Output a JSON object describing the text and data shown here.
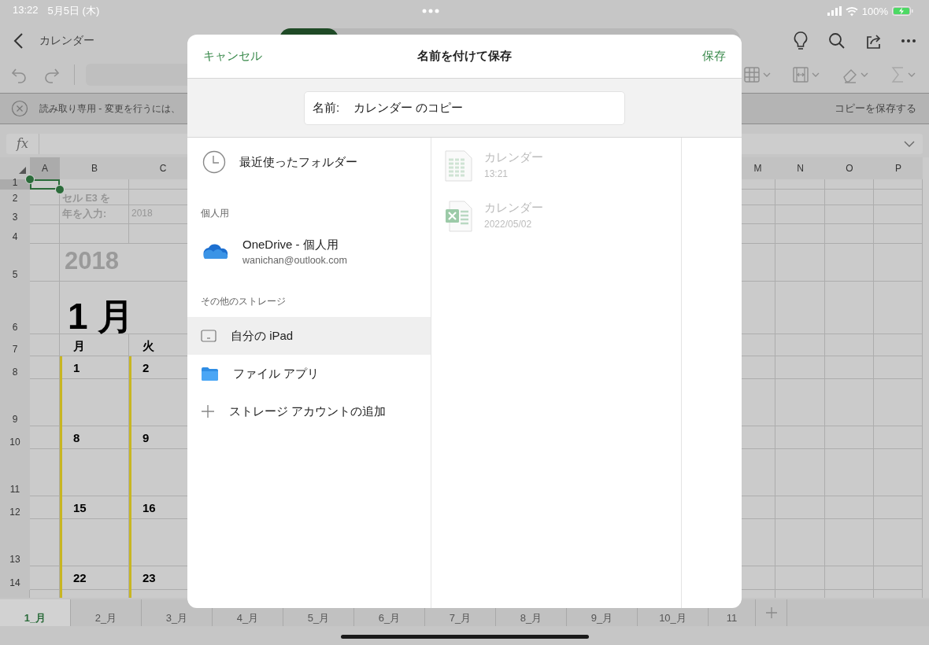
{
  "status_bar": {
    "time": "13:22",
    "date": "5月5日 (木)",
    "battery": "100%"
  },
  "header": {
    "title": "カレンダー"
  },
  "banner": {
    "message": "読み取り専用 - 変更を行うには、",
    "action": "コピーを保存する"
  },
  "formula_bar": {
    "label": "fx"
  },
  "grid": {
    "columns": [
      {
        "label": "A",
        "selected": true
      },
      {
        "label": "B",
        "selected": false
      },
      {
        "label": "C",
        "selected": false
      },
      {
        "label": "M",
        "selected": false
      },
      {
        "label": "N",
        "selected": false
      },
      {
        "label": "O",
        "selected": false
      },
      {
        "label": "P",
        "selected": false
      }
    ],
    "rows": [
      {
        "label": "1",
        "selected": true,
        "kind": "blank"
      },
      {
        "label": "2",
        "selected": false,
        "kind": "note",
        "b": "セル E3 を"
      },
      {
        "label": "3",
        "selected": false,
        "kind": "note",
        "b": "年を入力:",
        "c": "2018"
      },
      {
        "label": "4",
        "selected": false,
        "kind": "blank"
      },
      {
        "label": "5",
        "selected": false,
        "kind": "year",
        "b": "2018"
      },
      {
        "label": "6",
        "selected": false,
        "kind": "month",
        "b": "1 月"
      },
      {
        "label": "7",
        "selected": false,
        "kind": "weekday",
        "b": "月",
        "c": "火"
      },
      {
        "label": "8",
        "selected": false,
        "kind": "date",
        "b": "1",
        "c": "2"
      },
      {
        "label": "9",
        "selected": false,
        "kind": "blank"
      },
      {
        "label": "10",
        "selected": false,
        "kind": "date",
        "b": "8",
        "c": "9"
      },
      {
        "label": "11",
        "selected": false,
        "kind": "blank"
      },
      {
        "label": "12",
        "selected": false,
        "kind": "date",
        "b": "15",
        "c": "16"
      },
      {
        "label": "13",
        "selected": false,
        "kind": "blank"
      },
      {
        "label": "14",
        "selected": false,
        "kind": "date",
        "b": "22",
        "c": "23"
      }
    ]
  },
  "sheet_tabs": [
    {
      "label": "1_月",
      "selected": true
    },
    {
      "label": "2_月",
      "selected": false
    },
    {
      "label": "3_月",
      "selected": false
    },
    {
      "label": "4_月",
      "selected": false
    },
    {
      "label": "5_月",
      "selected": false
    },
    {
      "label": "6_月",
      "selected": false
    },
    {
      "label": "7_月",
      "selected": false
    },
    {
      "label": "8_月",
      "selected": false
    },
    {
      "label": "9_月",
      "selected": false
    },
    {
      "label": "10_月",
      "selected": false
    },
    {
      "label": "11",
      "selected": false
    }
  ],
  "dialog": {
    "cancel": "キャンセル",
    "title": "名前を付けて保存",
    "save": "保存",
    "name_label": "名前:",
    "name_value": "カレンダー のコピー",
    "locations": [
      {
        "kind": "recent",
        "label": "最近使ったフォルダー",
        "selected": false
      },
      {
        "kind": "section",
        "label": "個人用"
      },
      {
        "kind": "account",
        "label": "OneDrive - 個人用",
        "sub": "wanichan@outlook.com",
        "selected": false
      },
      {
        "kind": "section",
        "label": "その他のストレージ"
      },
      {
        "kind": "device",
        "label": "自分の iPad",
        "selected": true
      },
      {
        "kind": "folder",
        "label": "ファイル アプリ",
        "selected": false
      },
      {
        "kind": "add",
        "label": "ストレージ アカウントの追加",
        "selected": false
      }
    ],
    "files": [
      {
        "kind": "sheet",
        "name": "カレンダー",
        "date": "13:21",
        "disabled": true
      },
      {
        "kind": "excel",
        "name": "カレンダー",
        "date": "2022/05/02",
        "disabled": true
      }
    ]
  }
}
